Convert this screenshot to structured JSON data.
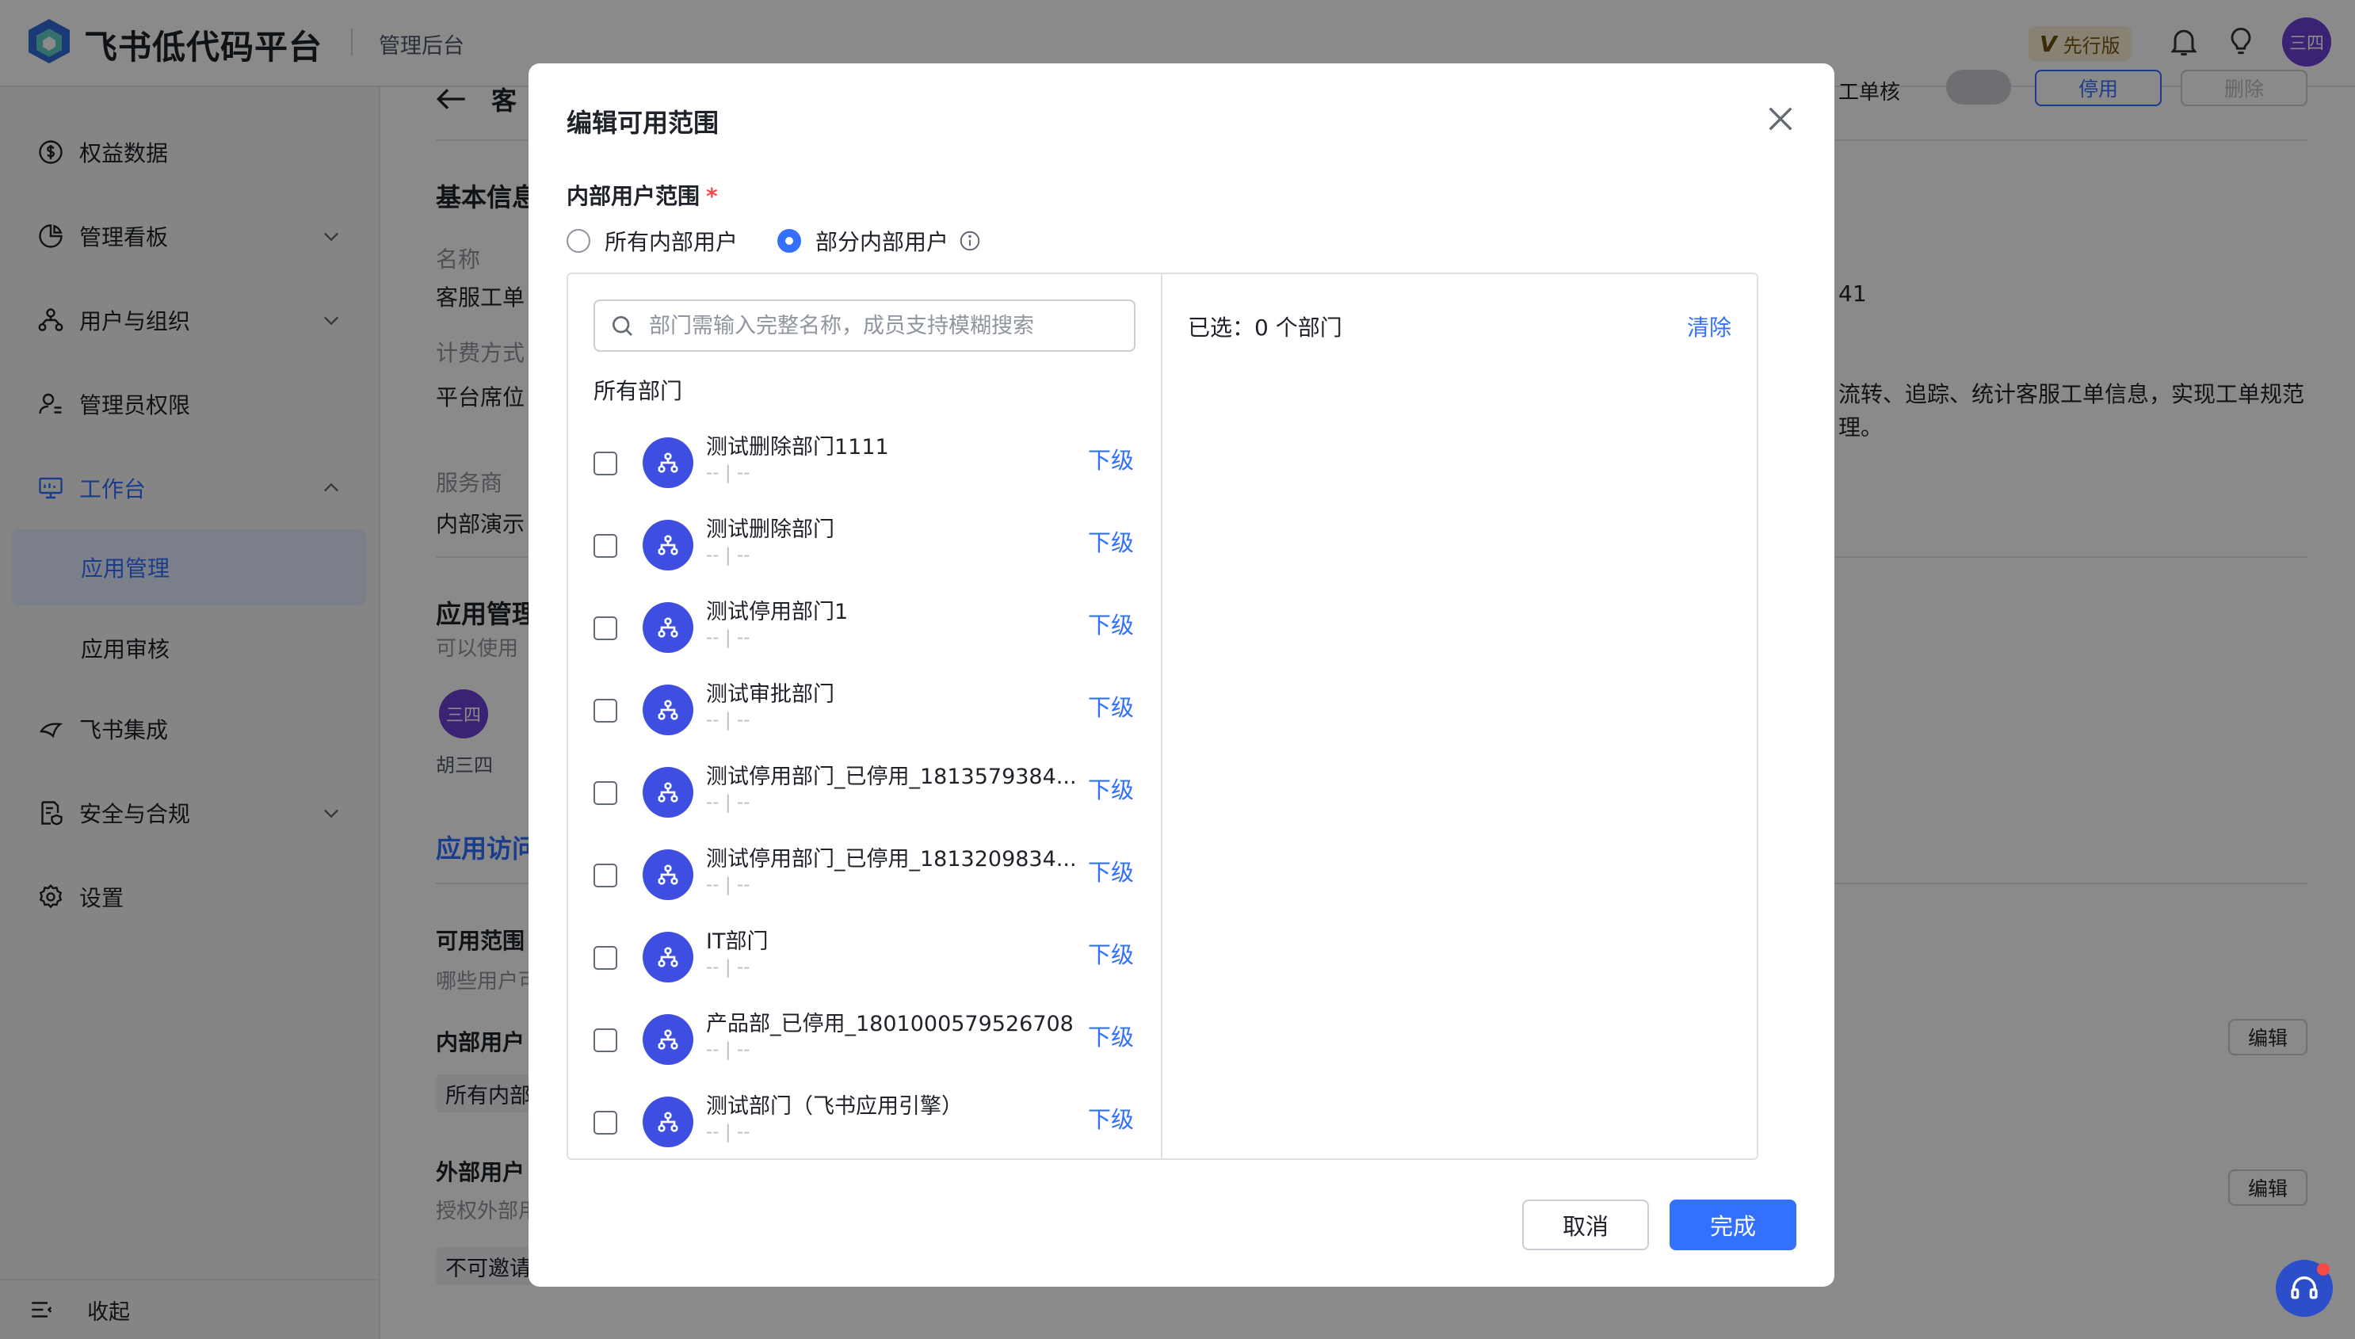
{
  "topbar": {
    "brand": "飞书低代码平台",
    "subbrand": "管理后台",
    "edition_badge": "V",
    "edition_label": "先行版",
    "avatar_text": "三四"
  },
  "sidebar": {
    "items": [
      {
        "label": "权益数据"
      },
      {
        "label": "管理看板"
      },
      {
        "label": "用户与组织"
      },
      {
        "label": "管理员权限"
      },
      {
        "label": "工作台"
      },
      {
        "label": "应用管理"
      },
      {
        "label": "应用审核"
      },
      {
        "label": "飞书集成"
      },
      {
        "label": "安全与合规"
      },
      {
        "label": "设置"
      }
    ],
    "collapse_label": "收起"
  },
  "background": {
    "back_title_fragment": "客",
    "toggle_label_fragment": "工单核",
    "stop_button": "停用",
    "delete_button": "删除",
    "basic_info": "基本信息",
    "name_label": "名称",
    "name_value": "客服工单",
    "billing_label": "计费方式",
    "billing_value": "平台席位",
    "provider_label": "服务商",
    "provider_value": "内部演示",
    "date_fragment": "41",
    "desc_line1": "流转、追踪、统计客服工单信息，实现工单规范",
    "desc_line2": "理。",
    "app_admin_heading": "应用管理",
    "app_admin_sub": "可以使用",
    "admin_avatar_text": "三四",
    "admin_name": "胡三四",
    "access_tab": "应用访问",
    "scope_label": "可用范围",
    "scope_sub": "哪些用户可",
    "internal_users_label": "内部用户",
    "internal_users_chip": "所有内部",
    "external_users_label": "外部用户",
    "external_users_sub": "授权外部用",
    "external_users_chip": "不可邀请",
    "edit_button": "编辑"
  },
  "modal": {
    "title": "编辑可用范围",
    "field_label": "内部用户范围",
    "required_mark": "*",
    "radio_all": "所有内部用户",
    "radio_partial": "部分内部用户",
    "search_placeholder": "部门需输入完整名称，成员支持模糊搜索",
    "all_departments": "所有部门",
    "next_level_label": "下级",
    "departments": [
      {
        "name": "测试删除部门1111",
        "sub": "-- | --"
      },
      {
        "name": "测试删除部门",
        "sub": "-- | --"
      },
      {
        "name": "测试停用部门1",
        "sub": "-- | --"
      },
      {
        "name": "测试审批部门",
        "sub": "-- | --"
      },
      {
        "name": "测试停用部门_已停用_1813579384...",
        "sub": "-- | --"
      },
      {
        "name": "测试停用部门_已停用_1813209834...",
        "sub": "-- | --"
      },
      {
        "name": "IT部门",
        "sub": "-- | --"
      },
      {
        "name": "产品部_已停用_1801000579526708",
        "sub": "-- | --"
      },
      {
        "name": "测试部门（飞书应用引擎）",
        "sub": "-- | --"
      }
    ],
    "selected_count": "已选：0 个部门",
    "clear_label": "清除",
    "cancel_label": "取消",
    "confirm_label": "完成"
  },
  "colors": {
    "accent": "#3370ff",
    "dept_avatar": "#3d4ee0",
    "overlay": "rgba(0,0,0,0.46)"
  }
}
